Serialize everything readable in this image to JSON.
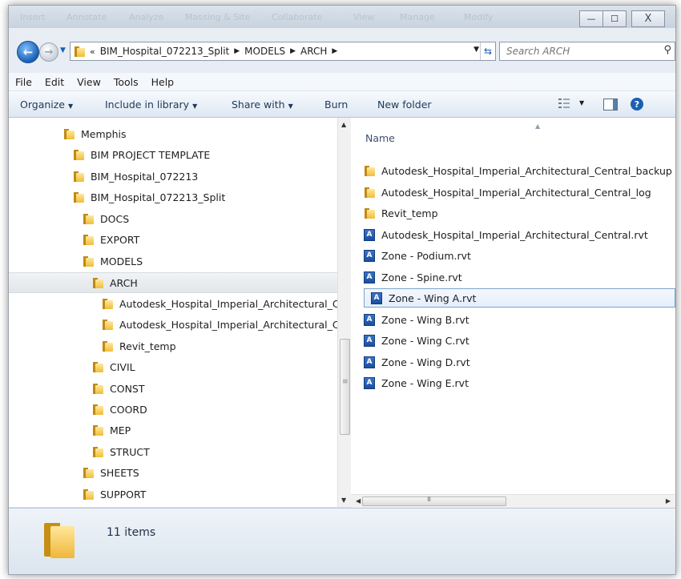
{
  "window": {
    "ribbon_tabs": [
      "Insert",
      "Annotate",
      "Analyze",
      "Massing & Site",
      "Collaborate",
      "View",
      "Manage",
      "Modify"
    ],
    "controls": {
      "minimize": "—",
      "maximize": "☐",
      "close": "X"
    }
  },
  "address": {
    "overflow": "«",
    "crumbs": [
      "BIM_Hospital_072213_Split",
      "MODELS",
      "ARCH"
    ],
    "search_placeholder": "Search ARCH"
  },
  "menu": [
    "File",
    "Edit",
    "View",
    "Tools",
    "Help"
  ],
  "toolbar": {
    "organize": "Organize",
    "include_in_library": "Include in library",
    "share_with": "Share with",
    "burn": "Burn",
    "new_folder": "New folder"
  },
  "tree": [
    {
      "label": "Memphis",
      "level": 0
    },
    {
      "label": "BIM PROJECT TEMPLATE",
      "level": 1
    },
    {
      "label": "BIM_Hospital_072213",
      "level": 1
    },
    {
      "label": "BIM_Hospital_072213_Split",
      "level": 1
    },
    {
      "label": "DOCS",
      "level": 2
    },
    {
      "label": "EXPORT",
      "level": 2
    },
    {
      "label": "MODELS",
      "level": 2
    },
    {
      "label": "ARCH",
      "level": 3,
      "selected": true
    },
    {
      "label": "Autodesk_Hospital_Imperial_Architectural_Central_backup",
      "level": 4
    },
    {
      "label": "Autodesk_Hospital_Imperial_Architectural_Central_log",
      "level": 4
    },
    {
      "label": "Revit_temp",
      "level": 4
    },
    {
      "label": "CIVIL",
      "level": 3
    },
    {
      "label": "CONST",
      "level": 3
    },
    {
      "label": "COORD",
      "level": 3
    },
    {
      "label": "MEP",
      "level": 3
    },
    {
      "label": "STRUCT",
      "level": 3
    },
    {
      "label": "SHEETS",
      "level": 2
    },
    {
      "label": "SUPPORT",
      "level": 2
    }
  ],
  "file_list": {
    "column_name": "Name",
    "items": [
      {
        "name": "Autodesk_Hospital_Imperial_Architectural_Central_backup",
        "type": "folder"
      },
      {
        "name": "Autodesk_Hospital_Imperial_Architectural_Central_log",
        "type": "folder"
      },
      {
        "name": "Revit_temp",
        "type": "folder"
      },
      {
        "name": "Autodesk_Hospital_Imperial_Architectural_Central.rvt",
        "type": "rvt"
      },
      {
        "name": "Zone - Podium.rvt",
        "type": "rvt"
      },
      {
        "name": "Zone - Spine.rvt",
        "type": "rvt"
      },
      {
        "name": "Zone - Wing A.rvt",
        "type": "rvt",
        "selected": true
      },
      {
        "name": "Zone - Wing B.rvt",
        "type": "rvt"
      },
      {
        "name": "Zone - Wing C.rvt",
        "type": "rvt"
      },
      {
        "name": "Zone - Wing D.rvt",
        "type": "rvt"
      },
      {
        "name": "Zone - Wing E.rvt",
        "type": "rvt"
      }
    ]
  },
  "details": {
    "item_count": "11 items"
  },
  "icons": {
    "revit_file": "A",
    "folder": "folder-icon"
  }
}
